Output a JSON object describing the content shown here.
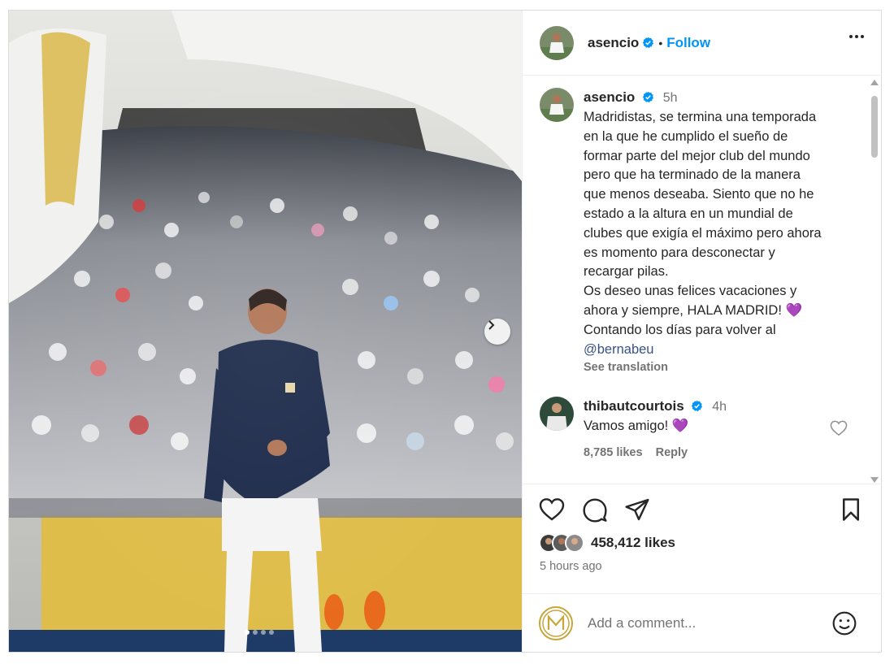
{
  "post": {
    "author": "asencio",
    "follow_label": "Follow",
    "separator": "•"
  },
  "caption": {
    "username": "asencio",
    "time": "5h",
    "text": "Madridistas, se termina una temporada\nen la que he cumplido el sueño de\nformar parte del mejor club del mundo\npero que ha terminado de la manera\nque menos deseaba. Siento que no he\nestado a la altura en un mundial de\nclubes que exigía el máximo pero ahora\nes momento para desconectar y\nrecargar pilas.\nOs deseo unas felices vacaciones y\nahora y siempre, HALA MADRID! 💜\nContando los días para volver al",
    "mention": "@bernabeu",
    "see_translation": "See translation"
  },
  "comment": {
    "username": "thibautcourtois",
    "time": "4h",
    "text": "Vamos amigo! 💜",
    "likes": "8,785 likes",
    "reply_label": "Reply"
  },
  "engagement": {
    "likes": "458,412 likes",
    "posted": "5 hours ago"
  },
  "add_comment": {
    "placeholder": "Add a comment..."
  },
  "icons": {
    "like": "heart-icon",
    "comment": "comment-icon",
    "share": "send-icon",
    "save": "bookmark-icon",
    "more": "more-options-icon",
    "emoji": "emoji-icon",
    "verified": "verified-badge-icon",
    "next": "chevron-right-icon"
  },
  "carousel": {
    "total_slides": 4,
    "active_slide": 1
  },
  "colors": {
    "accent": "#0095f6",
    "verified": "#0095f6",
    "text": "#262626",
    "muted": "#737373"
  }
}
